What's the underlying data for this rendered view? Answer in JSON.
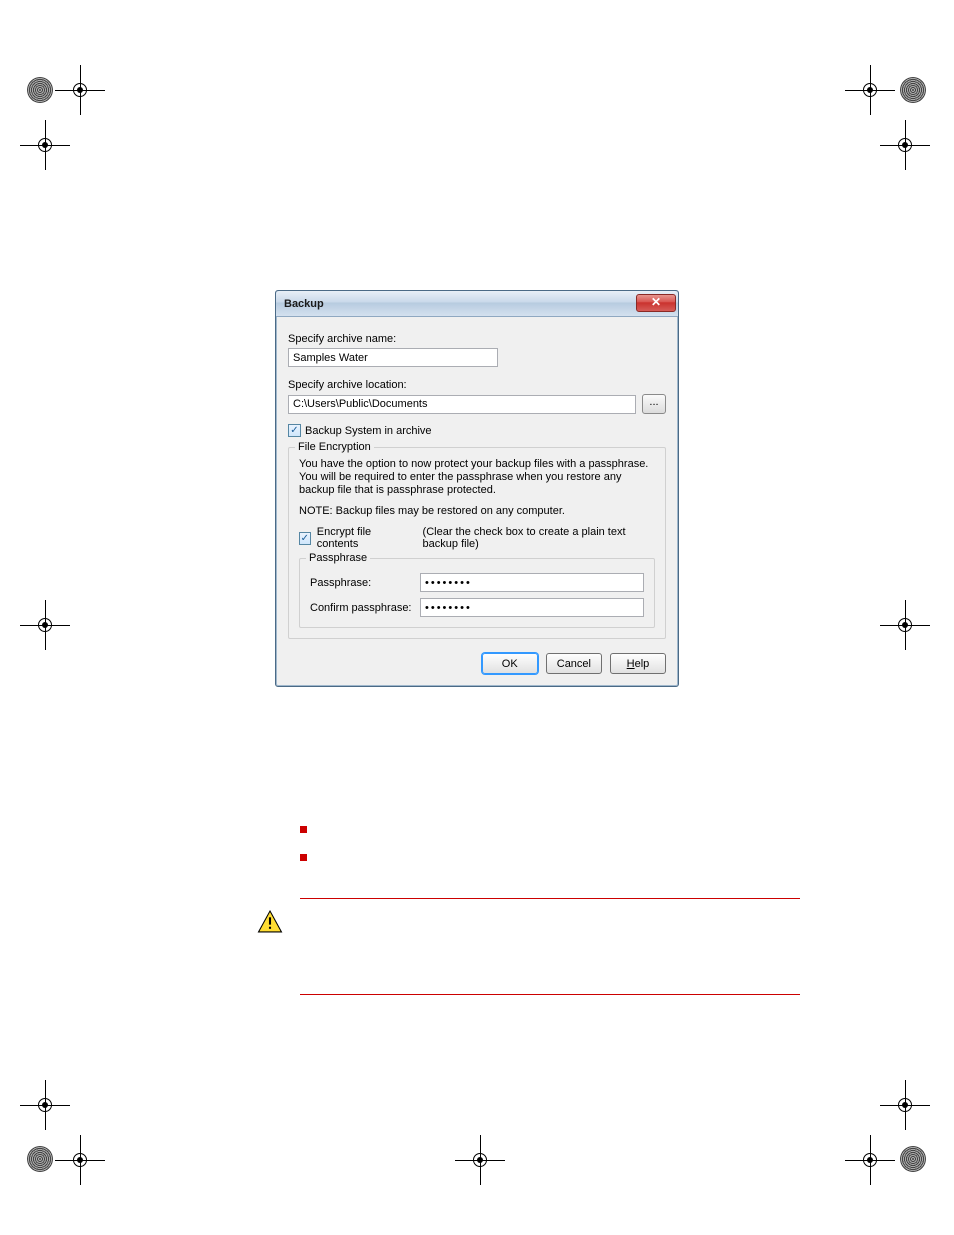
{
  "dialog": {
    "title": "Backup",
    "close_symbol": "✕",
    "archive_name_label": "Specify archive name:",
    "archive_name_value": "Samples Water",
    "archive_location_label": "Specify archive location:",
    "archive_location_value": "C:\\Users\\Public\\Documents",
    "browse_label": "...",
    "backup_system_checked": "✓",
    "backup_system_label": "Backup System in archive",
    "file_encryption_legend": "File Encryption",
    "encryption_text": "You have the option to now protect your backup files with a passphrase.  You will be required to enter the passphrase when you restore any backup file that is passphrase protected.",
    "encryption_note": "NOTE: Backup files may be restored on any computer.",
    "encrypt_checked": "✓",
    "encrypt_label": "Encrypt file contents",
    "encrypt_hint": "(Clear the check box to create a plain text backup file)",
    "passphrase_legend": "Passphrase",
    "passphrase_label": "Passphrase:",
    "passphrase_value": "••••••••",
    "confirm_label": "Confirm passphrase:",
    "confirm_value": "••••••••",
    "ok_label": "OK",
    "cancel_label": "Cancel",
    "help_label": "Help"
  }
}
